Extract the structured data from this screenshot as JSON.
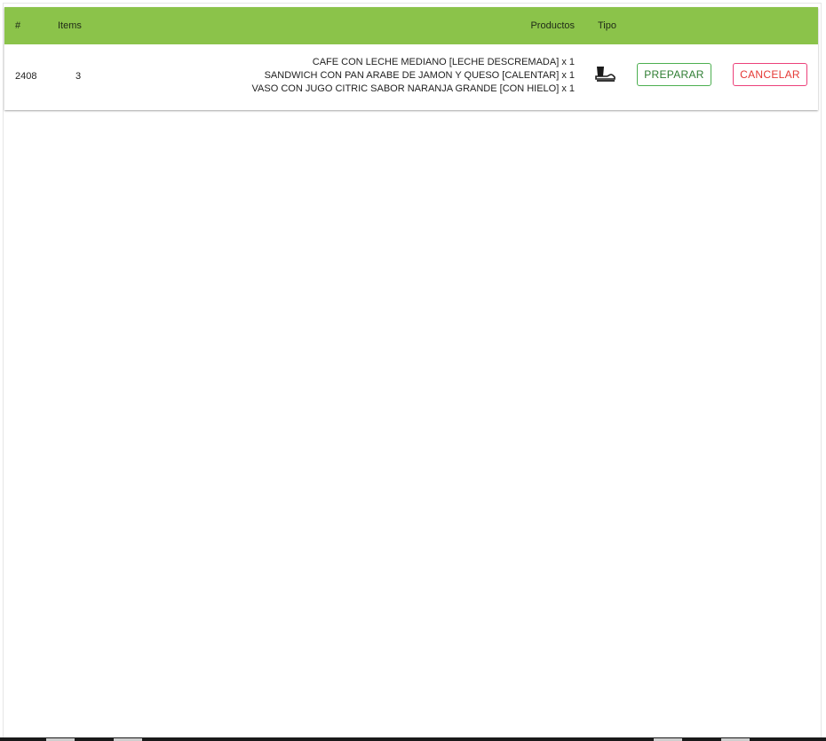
{
  "table": {
    "headers": {
      "number": "#",
      "items": "Items",
      "products": "Productos",
      "type": "Tipo"
    },
    "rows": [
      {
        "number": "2408",
        "items": "3",
        "products": [
          "CAFE CON LECHE MEDIANO [LECHE DESCREMADA] x 1",
          "SANDWICH CON PAN ARABE DE JAMON Y QUESO [CALENTAR] x 1",
          "VASO CON JUGO CITRIC SABOR NARANJA GRANDE [CON HIELO] x 1"
        ],
        "type_icon": "takeaway-food-icon",
        "prepare_label": "PREPARAR",
        "cancel_label": "CANCELAR"
      }
    ]
  },
  "colors": {
    "header_bg": "#8bc34a",
    "prepare": "#2e7d32",
    "cancel": "#e53935"
  }
}
